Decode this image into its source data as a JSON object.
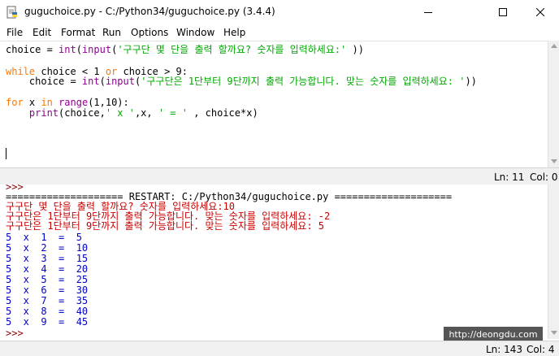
{
  "window": {
    "title": "guguchoice.py - C:/Python34/guguchoice.py (3.4.4)"
  },
  "menu": [
    "File",
    "Edit",
    "Format",
    "Run",
    "Options",
    "Window",
    "Help"
  ],
  "editor": {
    "line1": {
      "a": "choice = ",
      "b": "int",
      "c": "(",
      "d": "input",
      "e": "(",
      "f": "'구구단 몇 단을 출력 할까요? 숫자를 입력하세요:'",
      "g": " ))"
    },
    "line3": {
      "a": "while",
      "b": " choice < 1 ",
      "c": "or",
      "d": " choice > 9:"
    },
    "line4": {
      "a": "    choice = ",
      "b": "int",
      "c": "(",
      "d": "input",
      "e": "(",
      "f": "'구구단은 1단부터 9단까지 출력 가능합니다. 맞는 숫자를 입력하세요: '",
      "g": "))"
    },
    "line6": {
      "a": "for",
      "b": " x ",
      "c": "in",
      "d": " ",
      "e": "range",
      "f": "(1,10):"
    },
    "line7": {
      "a": "    ",
      "b": "print",
      "c": "(choice,",
      "d": "' x '",
      "e": ",x, ",
      "f": "' = '",
      "g": " , choice*x)"
    },
    "status": {
      "ln": "Ln: 11",
      "col": "Col: 0"
    }
  },
  "shell": {
    "top_prompt": ">>>",
    "restart": "==================== RESTART: C:/Python34/guguchoice.py ====================",
    "input1": "구구단 몇 단을 출력 할까요? 숫자를 입력하세요:10",
    "input2": "구구단은 1단부터 9단까지 출력 가능합니다. 맞는 숫자를 입력하세요: -2",
    "input3": "구구단은 1단부터 9단까지 출력 가능합니다. 맞는 숫자를 입력하세요: 5",
    "results": [
      "5  x  1  =  5",
      "5  x  2  =  10",
      "5  x  3  =  15",
      "5  x  4  =  20",
      "5  x  5  =  25",
      "5  x  6  =  30",
      "5  x  7  =  35",
      "5  x  8  =  40",
      "5  x  9  =  45"
    ],
    "bottom_prompt": ">>>",
    "watermark": "http://deongdu.com",
    "status": {
      "ln": "Ln: 143",
      "col": "Col: 4"
    }
  }
}
